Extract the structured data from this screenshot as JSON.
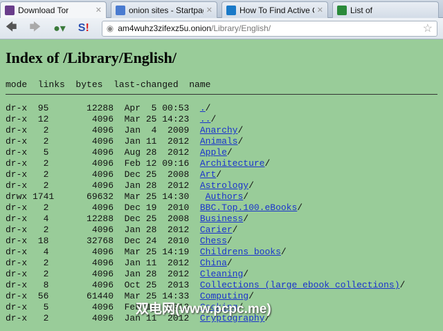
{
  "tabs": [
    {
      "title": "Download Tor",
      "icon": "tor-onion-icon",
      "color": "#6a3d8a"
    },
    {
      "title": "onion sites - Startpage Sea...",
      "icon": "startpage-icon",
      "color": "#4a7bd0"
    },
    {
      "title": "How To Find Active Onion...",
      "icon": "makeuseof-icon",
      "color": "#1a7ac8"
    },
    {
      "title": "List of",
      "icon": "s-icon",
      "color": "#2a8a3a"
    }
  ],
  "nav": {
    "url_host": "am4wuhz3zifexz5u.onion",
    "url_path": "/Library/English/"
  },
  "page": {
    "title": "Index of /Library/English/",
    "header": "mode  links  bytes  last-changed  name",
    "rows": [
      {
        "mode": "dr-x",
        "links": "95",
        "bytes": "12288",
        "date": "Apr  5 00:53",
        "name": ".",
        "lead": ""
      },
      {
        "mode": "dr-x",
        "links": "12",
        "bytes": "4096",
        "date": "Mar 25 14:23",
        "name": "..",
        "lead": ""
      },
      {
        "mode": "dr-x",
        "links": "2",
        "bytes": "4096",
        "date": "Jan  4  2009",
        "name": "Anarchy",
        "lead": ""
      },
      {
        "mode": "dr-x",
        "links": "2",
        "bytes": "4096",
        "date": "Jan 11  2012",
        "name": "Animals",
        "lead": ""
      },
      {
        "mode": "dr-x",
        "links": "5",
        "bytes": "4096",
        "date": "Aug 28  2012",
        "name": "Apple",
        "lead": ""
      },
      {
        "mode": "dr-x",
        "links": "2",
        "bytes": "4096",
        "date": "Feb 12 09:16",
        "name": "Architecture",
        "lead": ""
      },
      {
        "mode": "dr-x",
        "links": "2",
        "bytes": "4096",
        "date": "Dec 25  2008",
        "name": "Art",
        "lead": ""
      },
      {
        "mode": "dr-x",
        "links": "2",
        "bytes": "4096",
        "date": "Jan 28  2012",
        "name": "Astrology",
        "lead": ""
      },
      {
        "mode": "drwx",
        "links": "1741",
        "bytes": "69632",
        "date": "Mar 25 14:30",
        "name": "Authors",
        "lead": " "
      },
      {
        "mode": "dr-x",
        "links": "2",
        "bytes": "4096",
        "date": "Dec 19  2010",
        "name": "BBC.Top.100.eBooks",
        "lead": ""
      },
      {
        "mode": "dr-x",
        "links": "4",
        "bytes": "12288",
        "date": "Dec 25  2008",
        "name": "Business",
        "lead": ""
      },
      {
        "mode": "dr-x",
        "links": "2",
        "bytes": "4096",
        "date": "Jan 28  2012",
        "name": "Carier",
        "lead": ""
      },
      {
        "mode": "dr-x",
        "links": "18",
        "bytes": "32768",
        "date": "Dec 24  2010",
        "name": "Chess",
        "lead": ""
      },
      {
        "mode": "dr-x",
        "links": "4",
        "bytes": "4096",
        "date": "Mar 25 14:19",
        "name": "Childrens books",
        "lead": ""
      },
      {
        "mode": "dr-x",
        "links": "2",
        "bytes": "4096",
        "date": "Jan 11  2012",
        "name": "China",
        "lead": ""
      },
      {
        "mode": "dr-x",
        "links": "2",
        "bytes": "4096",
        "date": "Jan 28  2012",
        "name": "Cleaning",
        "lead": ""
      },
      {
        "mode": "dr-x",
        "links": "8",
        "bytes": "4096",
        "date": "Oct 25  2013",
        "name": "Collections (large ebook collections)",
        "lead": ""
      },
      {
        "mode": "dr-x",
        "links": "56",
        "bytes": "61440",
        "date": "Mar 25 14:33",
        "name": "Computing",
        "lead": ""
      },
      {
        "mode": "dr-x",
        "links": "5",
        "bytes": "4096",
        "date": "Feb 15  2012",
        "name": "Cooking",
        "lead": ""
      },
      {
        "mode": "dr-x",
        "links": "2",
        "bytes": "4096",
        "date": "Jan 11  2012",
        "name": "Cryptography",
        "lead": ""
      }
    ]
  },
  "watermark": "双电网(www.pcpc.me)"
}
